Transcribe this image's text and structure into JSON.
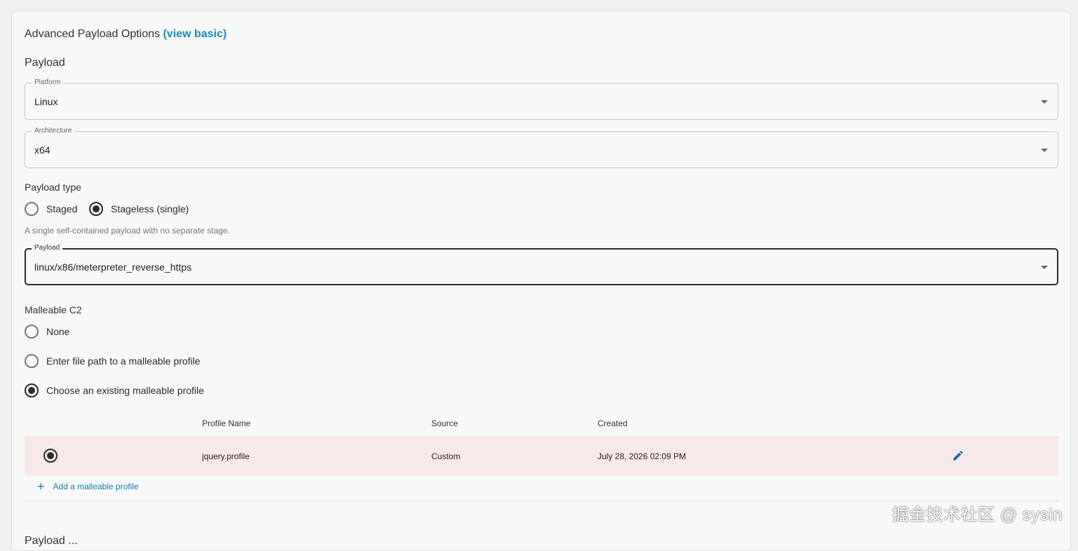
{
  "header": {
    "title": "Advanced Payload Options",
    "view_basic_link": "(view basic)"
  },
  "payload_section": {
    "title": "Payload",
    "platform": {
      "label": "Platform",
      "value": "Linux"
    },
    "architecture": {
      "label": "Architecture",
      "value": "x64"
    },
    "payload_type": {
      "label": "Payload type",
      "options": [
        {
          "label": "Staged",
          "checked": false
        },
        {
          "label": "Stageless (single)",
          "checked": true
        }
      ],
      "helper": "A single self-contained payload with no separate stage."
    },
    "payload": {
      "label": "Payload",
      "value": "linux/x86/meterpreter_reverse_https"
    }
  },
  "malleable_c2": {
    "label": "Malleable C2",
    "options": [
      {
        "label": "None",
        "checked": false
      },
      {
        "label": "Enter file path to a malleable profile",
        "checked": false
      },
      {
        "label": "Choose an existing malleable profile",
        "checked": true
      }
    ],
    "table": {
      "columns": [
        "Profile Name",
        "Source",
        "Created"
      ],
      "rows": [
        {
          "selected": true,
          "name": "jquery.profile",
          "source": "Custom",
          "created": "July 28, 2026 02:09 PM"
        }
      ]
    },
    "add_label": "Add a malleable profile"
  },
  "next_section_partial": "Payload ...",
  "watermark": "掘金技术社区 @ sysin",
  "colors": {
    "accent_link": "#1a8fb4",
    "selected_row": "#f6e9e7",
    "edit_icon": "#1a6fb0"
  },
  "icons": {
    "dropdown": "caret-down-icon",
    "edit": "pencil-icon",
    "add": "plus-icon"
  }
}
